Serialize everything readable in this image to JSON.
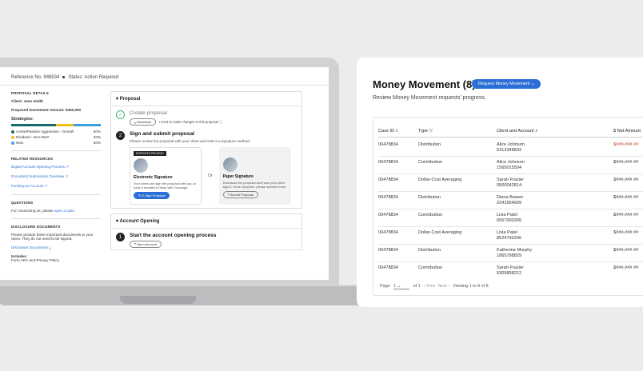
{
  "left_app": {
    "reference": "Reference No. 948934",
    "status": "Status: Action Required",
    "details": {
      "heading": "PROPOSAL DETAILS",
      "client": "Client: Jane Smith",
      "investment": "Proposed Investment Amount: $450,000",
      "strategies_label": "Strategies:",
      "strategies": [
        {
          "name": "Active/Passive Aggressive - Growth",
          "pct": "50%",
          "color": "#1a6b6b"
        },
        {
          "name": "Dividend - Non-MLP",
          "pct": "20%",
          "color": "#f0c21b"
        },
        {
          "name": "New",
          "pct": "30%",
          "color": "#3aa0e0"
        }
      ]
    },
    "resources": {
      "heading": "RELATED RESOURCES",
      "links": [
        "Digital Account Opening Process",
        "Document Submission Overview",
        "Funding an Account"
      ]
    },
    "questions": {
      "heading": "QUESTIONS",
      "text": "For connecting us, please",
      "link": "open a case"
    },
    "disclosures": {
      "heading": "DISCLOSURE DOCUMENTS",
      "text": "Please provide these important documents to your client. They do not need to be signed.",
      "link": "Disclosure Documents",
      "includes_label": "Includes:",
      "includes": "Form ADV and Privacy Policy"
    },
    "proposal": {
      "title": "Proposal",
      "step1_title": "Create proposal",
      "download": "Download",
      "changes": "I need to make changes to this proposal",
      "step2_num": "2",
      "step2_title": "Sign and submit proposal",
      "step2_desc": "Please review the proposal with your client and select a signature method:",
      "esign_tag": "EXPEDITED PROCESS",
      "esign_title": "Electronic Signature",
      "esign_desc": "Your client can sign the proposal with you or have it emailed to them with Docusign.",
      "esign_button": "E-Sign Proposal",
      "or": "Or",
      "paper_title": "Paper Signature",
      "paper_desc": "Download the proposal and have your client sign it. Once complete, please submit it here.",
      "paper_button": "Submit Proposal"
    },
    "account_opening": {
      "title": "Account Opening",
      "step_num": "1",
      "step_title": "Start the account opening process",
      "button": "Open Account"
    }
  },
  "right_app": {
    "title": "Money Movement (8)",
    "request_button": "Request Money Movement",
    "description": "Review Money Movement requests' progress.",
    "columns": [
      "Case ID",
      "Type",
      "Client and Account",
      "$ Net Amount"
    ],
    "rows": [
      {
        "case": "00478834",
        "type": "Distribution",
        "client": "Alice Johnson",
        "account": "5312348832",
        "amount": "$###,### ##",
        "negative": true
      },
      {
        "case": "00478834",
        "type": "Contribution",
        "client": "Alice Johnson",
        "account": "1565015504",
        "amount": "$###,### ##",
        "negative": false
      },
      {
        "case": "00478834",
        "type": "Dollar-Cost Averaging",
        "client": "Sarah Frazier",
        "account": "0500042814",
        "amount": "$###,### ##",
        "negative": false
      },
      {
        "case": "00478834",
        "type": "Distribution",
        "client": "Diana Bowen",
        "account": "2241564609",
        "amount": "$###,### ##",
        "negative": false
      },
      {
        "case": "00478834",
        "type": "Contribution",
        "client": "Livia Patel",
        "account": "6557000265",
        "amount": "$###,### ##",
        "negative": false
      },
      {
        "case": "00478834",
        "type": "Dollar-Cost Averaging",
        "client": "Livia Patel",
        "account": "8524792206",
        "amount": "$###,### ##",
        "negative": false
      },
      {
        "case": "00478834",
        "type": "Distribution",
        "client": "Katherine Murphy",
        "account": "1865798829",
        "amount": "$###,### ##",
        "negative": false
      },
      {
        "case": "00478834",
        "type": "Contribution",
        "client": "Sarah Frazier",
        "account": "5305858212",
        "amount": "$###,### ##",
        "negative": false
      }
    ],
    "footer": {
      "page_label": "Page",
      "page_value": "1",
      "of": "of 1",
      "prev": "Prev",
      "next": "Next",
      "viewing": "Viewing 1 to 8 of 8"
    }
  }
}
